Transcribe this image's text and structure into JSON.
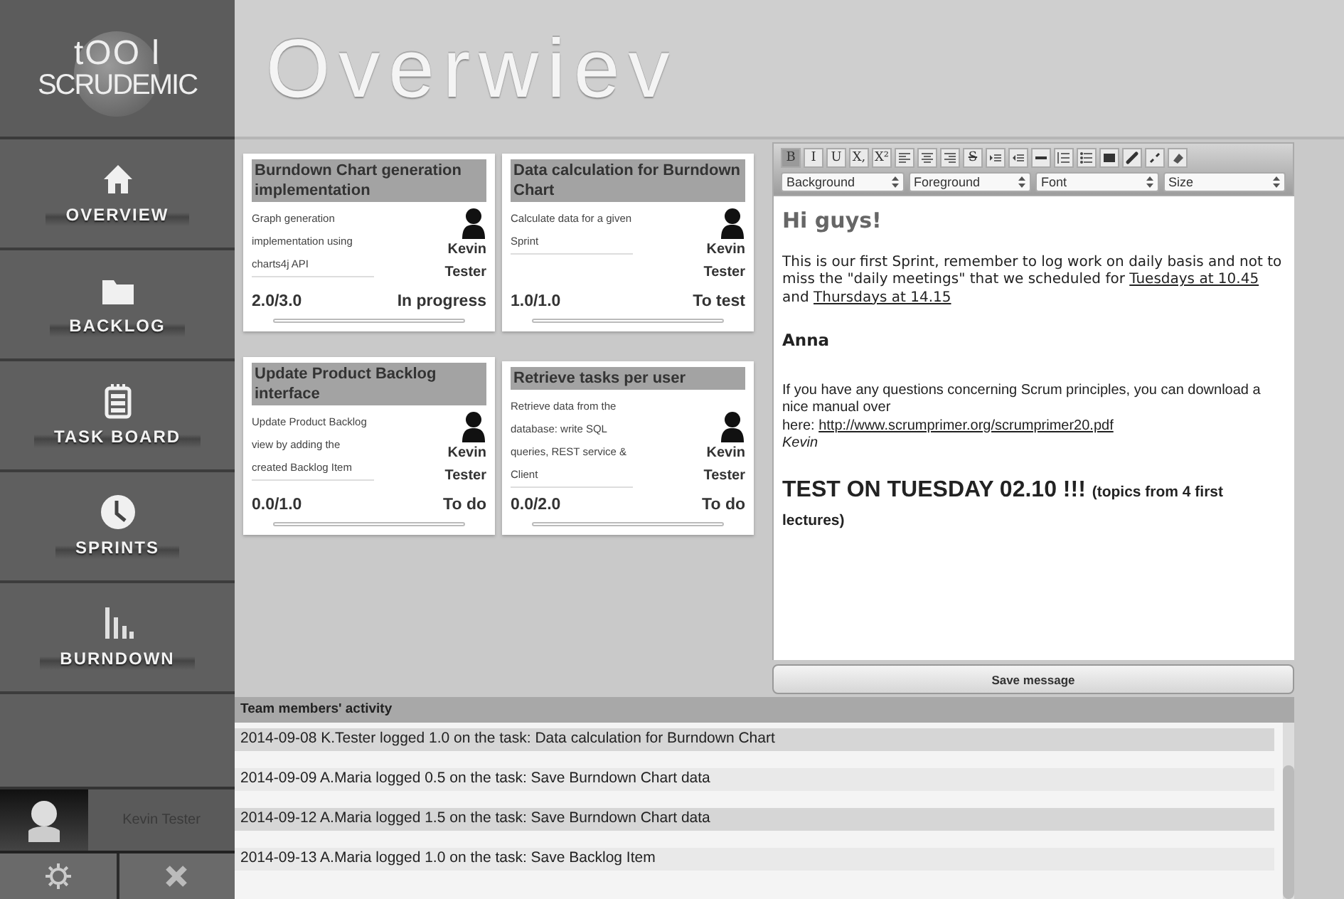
{
  "logo": {
    "top": "tOO l",
    "bottom": "SCRUDEMIC"
  },
  "title": "Overwiev",
  "nav": [
    {
      "label": "OVERVIEW",
      "kind": "home"
    },
    {
      "label": "BACKLOG",
      "kind": "folder"
    },
    {
      "label": "TASK BOARD",
      "kind": "board"
    },
    {
      "label": "SPRINTS",
      "kind": "clock"
    },
    {
      "label": "BURNDOWN",
      "kind": "bars"
    }
  ],
  "user": {
    "name": "Kevin Tester"
  },
  "cards": [
    {
      "title": "Burndown Chart generation implementation",
      "description": "Graph generation implementation using charts4j API",
      "assignee": [
        "Kevin",
        "Tester"
      ],
      "hours": "2.0/3.0",
      "status": "In progress"
    },
    {
      "title": "Data calculation for Burndown Chart",
      "description": "Calculate data for a given Sprint",
      "assignee": [
        "Kevin",
        "Tester"
      ],
      "hours": "1.0/1.0",
      "status": "To test"
    },
    {
      "title": "Update Product Backlog interface",
      "description": "Update Product Backlog view by adding the created Backlog Item",
      "assignee": [
        "Kevin",
        "Tester"
      ],
      "hours": "0.0/1.0",
      "status": "To do"
    },
    {
      "title": "Retrieve tasks per user",
      "description": "Retrieve data from the database: write SQL queries, REST service & Client",
      "assignee": [
        "Kevin",
        "Tester"
      ],
      "hours": "0.0/2.0",
      "status": "To do"
    }
  ],
  "editor": {
    "tools": [
      {
        "kind": "glyph",
        "label": "B",
        "selected": true
      },
      {
        "kind": "glyph",
        "label": "I",
        "selected": false
      },
      {
        "kind": "glyph",
        "label": "U",
        "selected": false
      },
      {
        "kind": "glyph",
        "label": "X,",
        "selected": false
      },
      {
        "kind": "glyph",
        "label": "X²",
        "selected": false
      },
      {
        "kind": "alignleft",
        "selected": false
      },
      {
        "kind": "aligncenter",
        "selected": false
      },
      {
        "kind": "alignright",
        "selected": false
      },
      {
        "kind": "strike",
        "label": "S",
        "selected": false
      },
      {
        "kind": "indent",
        "selected": false
      },
      {
        "kind": "outdent",
        "selected": false
      },
      {
        "kind": "rule",
        "selected": false
      },
      {
        "kind": "numbered",
        "selected": false
      },
      {
        "kind": "bulleted",
        "selected": false
      },
      {
        "kind": "image",
        "selected": false
      },
      {
        "kind": "link",
        "selected": false
      },
      {
        "kind": "unlink",
        "selected": false
      },
      {
        "kind": "eraser",
        "selected": false
      }
    ],
    "selects": [
      "Background",
      "Foreground",
      "Font",
      "Size"
    ],
    "blocks": [
      {
        "kind": "heading",
        "parts": [
          {
            "text": "Hi guys!"
          }
        ]
      },
      {
        "kind": "para",
        "parts": [
          {
            "text": "This is our first Sprint, remember to log work on daily basis and not to miss the \"daily meetings\" that we scheduled for "
          },
          {
            "text": "Tuesdays at 10.45",
            "link": true
          },
          {
            "text": " and "
          },
          {
            "text": "Thursdays at 14.15",
            "link": true
          }
        ]
      },
      {
        "kind": "name",
        "parts": [
          {
            "text": "Anna"
          }
        ]
      },
      {
        "kind": "small",
        "parts": [
          {
            "text": "If you have any questions concerning Scrum principles, you can download  a nice manual over"
          }
        ]
      },
      {
        "kind": "small",
        "parts": [
          {
            "text": "here: "
          },
          {
            "text": "http://www.scrumprimer.org/scrumprimer20.pdf",
            "link": true
          }
        ]
      },
      {
        "kind": "signature",
        "parts": [
          {
            "text": "Kevin"
          }
        ]
      },
      {
        "kind": "big",
        "parts": [
          {
            "text": "TEST ON TUESDAY 02.10 !!! "
          },
          {
            "text": "(topics from 4 first lectures)",
            "minor": true
          }
        ]
      }
    ],
    "save": "Save message"
  },
  "activity": {
    "title": "Team members' activity",
    "rows": [
      "2014-09-08 K.Tester logged 1.0 on the task: Data calculation for Burndown Chart",
      "2014-09-09 A.Maria logged 0.5 on the task: Save Burndown Chart data",
      "2014-09-12 A.Maria logged 1.5 on the task: Save Burndown Chart data",
      "2014-09-13 A.Maria logged 1.0 on the task: Save Backlog Item"
    ]
  }
}
